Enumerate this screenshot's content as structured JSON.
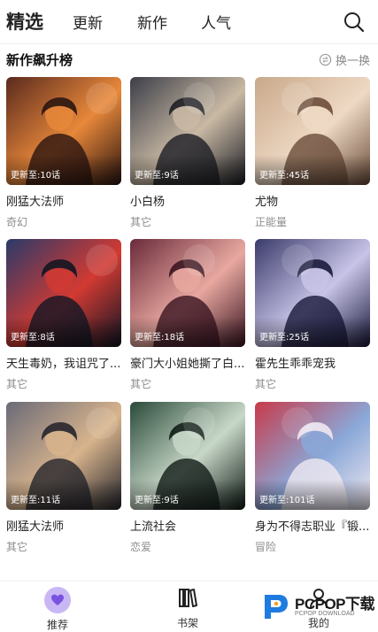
{
  "tabs": [
    {
      "label": "精选",
      "active": true
    },
    {
      "label": "更新",
      "active": false
    },
    {
      "label": "新作",
      "active": false
    },
    {
      "label": "人气",
      "active": false
    }
  ],
  "section": {
    "title": "新作飙升榜",
    "swap_label": "换一换"
  },
  "cards": [
    {
      "title": "刚猛大法师",
      "genre": "奇幻",
      "update": "更新至:10话",
      "palette": [
        "#5a2a1e",
        "#e8883a",
        "#2a1410"
      ]
    },
    {
      "title": "小白杨",
      "genre": "其它",
      "update": "更新至:9话",
      "palette": [
        "#3c3e48",
        "#c9b9a4",
        "#1c1d24"
      ]
    },
    {
      "title": "尤物",
      "genre": "正能量",
      "update": "更新至:45话",
      "palette": [
        "#c9a88a",
        "#eed9c4",
        "#6a4c3a"
      ]
    },
    {
      "title": "天生毒奶，我诅咒了...",
      "genre": "其它",
      "update": "更新至:8话",
      "palette": [
        "#2a3a6a",
        "#d23a32",
        "#101624"
      ]
    },
    {
      "title": "豪门大小姐她撕了白...",
      "genre": "其它",
      "update": "更新至:18话",
      "palette": [
        "#6a2a3a",
        "#e8a8a0",
        "#3a1420"
      ]
    },
    {
      "title": "霍先生乖乖宠我",
      "genre": "其它",
      "update": "更新至:25话",
      "palette": [
        "#3a3a6a",
        "#c8c4e8",
        "#18183a"
      ]
    },
    {
      "title": "刚猛大法师",
      "genre": "其它",
      "update": "更新至:11话",
      "palette": [
        "#6a6a78",
        "#d8b48c",
        "#24242c"
      ]
    },
    {
      "title": "上流社会",
      "genre": "恋爱",
      "update": "更新至:9话",
      "palette": [
        "#2a4a3a",
        "#c8d8c8",
        "#101c16"
      ]
    },
    {
      "title": "身为不得志职业『锻...",
      "genre": "冒险",
      "update": "更新至:101话",
      "palette": [
        "#c83a4a",
        "#8aa8d8",
        "#f0e8f0"
      ]
    }
  ],
  "bottom_nav": [
    {
      "label": "推荐",
      "icon": "heart-icon",
      "active": true
    },
    {
      "label": "书架",
      "icon": "bookshelf-icon",
      "active": false
    },
    {
      "label": "我的",
      "icon": "profile-icon",
      "active": false
    }
  ],
  "watermark": {
    "text": "PCPOP下载",
    "sub": "PCPOP DOWNLOAD"
  },
  "colors": {
    "accent": "#c9b7f5",
    "accent_dark": "#7a52e0",
    "muted_text": "#8c8c8c"
  }
}
